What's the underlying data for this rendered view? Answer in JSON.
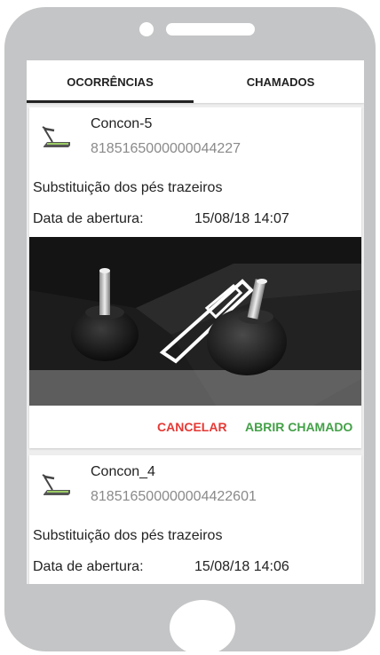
{
  "tabs": {
    "occurrences": "OCORRÊNCIAS",
    "calls": "CHAMADOS",
    "active": "occurrences"
  },
  "cards": [
    {
      "icon": "treadmill-icon",
      "equipment_name": "Concon-5",
      "equipment_code": "8185165000000044227",
      "description": "Substituição dos pés trazeiros",
      "date_label": "Data de abertura:",
      "date_value": "15/08/18 14:07",
      "cancel_label": "CANCELAR",
      "open_label": "ABRIR CHAMADO"
    },
    {
      "icon": "treadmill-icon",
      "equipment_name": "Concon_4",
      "equipment_code": "818516500000004422601",
      "description": "Substituição dos pés trazeiros",
      "date_label": "Data de abertura:",
      "date_value": "15/08/18 14:06"
    }
  ],
  "colors": {
    "cancel": "#e53935",
    "open_call": "#43a047",
    "device_frame": "#c4c5c6"
  }
}
